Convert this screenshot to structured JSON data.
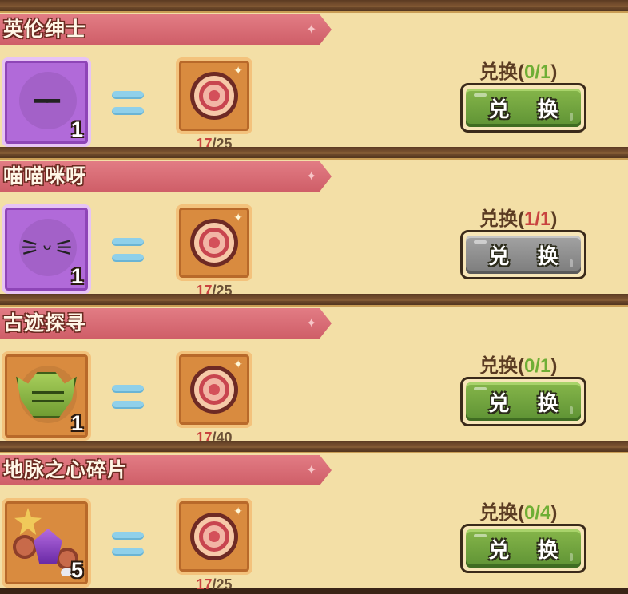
{
  "exchange_label": "兑换",
  "button_label": "兑 换",
  "rows": [
    {
      "title": "英伦绅士",
      "item_icon": "mustache-face-icon",
      "item_face": "━━",
      "item_qty": "1",
      "cost_have": "17",
      "cost_sep": "/",
      "cost_need": "25",
      "count_open": "(",
      "count": "0/1",
      "count_close": ")",
      "button_state": "enabled"
    },
    {
      "title": "喵喵咪呀",
      "item_icon": "cat-whiskers-face-icon",
      "item_face": "⚞ ᵕ ⚟",
      "item_qty": "1",
      "cost_have": "17",
      "cost_sep": "/",
      "cost_need": "25",
      "count_open": "(",
      "count": "1/1",
      "count_close": ")",
      "button_state": "disabled"
    },
    {
      "title": "古迹探寻",
      "item_icon": "green-mask-icon",
      "item_qty": "1",
      "cost_have": "17",
      "cost_sep": "/",
      "cost_need": "40",
      "count_open": "(",
      "count": "0/1",
      "count_close": ")",
      "button_state": "enabled"
    },
    {
      "title": "地脉之心碎片",
      "item_icon": "earth-heart-shard-icon",
      "item_qty": "5",
      "cost_have": "17",
      "cost_sep": "/",
      "cost_need": "25",
      "count_open": "(",
      "count": "0/4",
      "count_close": ")",
      "button_state": "enabled"
    }
  ],
  "colors": {
    "panel": "#f3dfa6",
    "ribbon": "#d9666f",
    "button_enabled": "#6fa33c",
    "button_disabled": "#8a8a8a",
    "count_available": "#6fae35",
    "count_full": "#c9433f",
    "cost_have": "#c9433f"
  },
  "cost_icon": "target-coin-icon"
}
